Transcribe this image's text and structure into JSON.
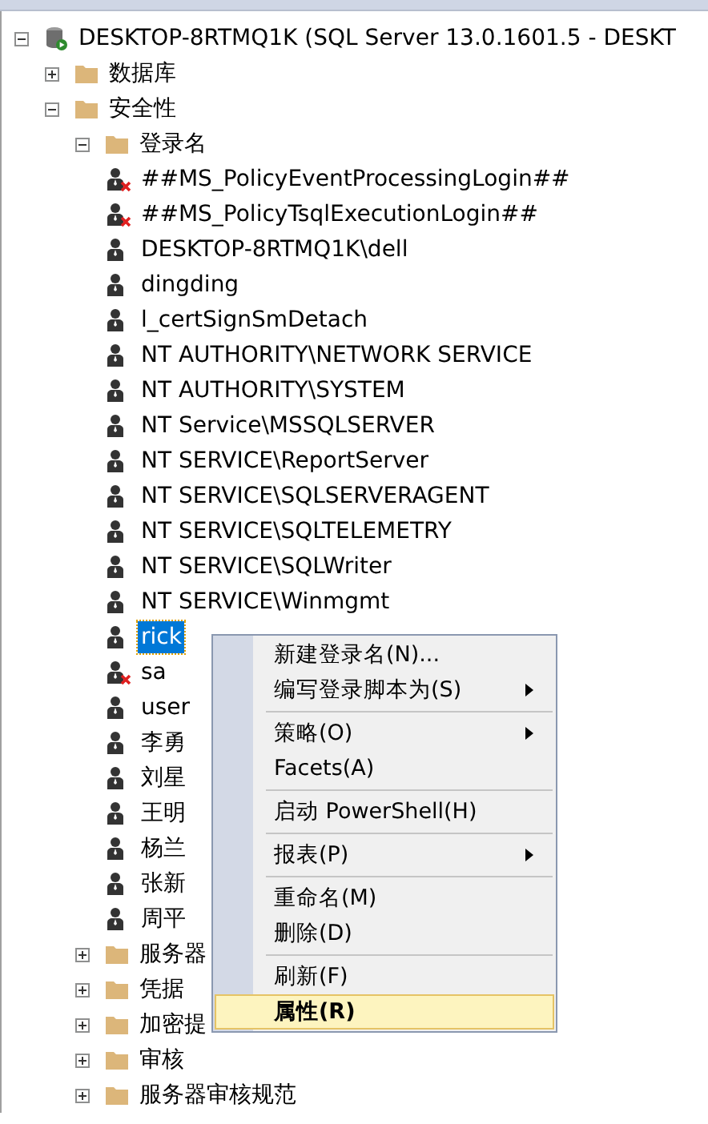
{
  "tree": {
    "label": "DESKTOP-8RTMQ1K (SQL Server 13.0.1601.5 - DESKT",
    "kind": "server",
    "expanded": true,
    "children": [
      {
        "label": "数据库",
        "kind": "folder",
        "expanded": false
      },
      {
        "label": "安全性",
        "kind": "folder",
        "expanded": true,
        "children": [
          {
            "label": "登录名",
            "kind": "folder",
            "expanded": true,
            "children": [
              {
                "label": "##MS_PolicyEventProcessingLogin##",
                "kind": "login",
                "disabled": true,
                "selected": false
              },
              {
                "label": "##MS_PolicyTsqlExecutionLogin##",
                "kind": "login",
                "disabled": true,
                "selected": false
              },
              {
                "label": "DESKTOP-8RTMQ1K\\dell",
                "kind": "login",
                "disabled": false,
                "selected": false
              },
              {
                "label": "dingding",
                "kind": "login",
                "disabled": false,
                "selected": false
              },
              {
                "label": "l_certSignSmDetach",
                "kind": "login",
                "disabled": false,
                "selected": false
              },
              {
                "label": "NT AUTHORITY\\NETWORK SERVICE",
                "kind": "login",
                "disabled": false,
                "selected": false
              },
              {
                "label": "NT AUTHORITY\\SYSTEM",
                "kind": "login",
                "disabled": false,
                "selected": false
              },
              {
                "label": "NT Service\\MSSQLSERVER",
                "kind": "login",
                "disabled": false,
                "selected": false
              },
              {
                "label": "NT SERVICE\\ReportServer",
                "kind": "login",
                "disabled": false,
                "selected": false
              },
              {
                "label": "NT SERVICE\\SQLSERVERAGENT",
                "kind": "login",
                "disabled": false,
                "selected": false
              },
              {
                "label": "NT SERVICE\\SQLTELEMETRY",
                "kind": "login",
                "disabled": false,
                "selected": false
              },
              {
                "label": "NT SERVICE\\SQLWriter",
                "kind": "login",
                "disabled": false,
                "selected": false
              },
              {
                "label": "NT SERVICE\\Winmgmt",
                "kind": "login",
                "disabled": false,
                "selected": false
              },
              {
                "label": "rick",
                "kind": "login",
                "disabled": false,
                "selected": true
              },
              {
                "label": "sa",
                "kind": "login",
                "disabled": true,
                "selected": false
              },
              {
                "label": "user",
                "kind": "login",
                "disabled": false,
                "selected": false
              },
              {
                "label": "李勇",
                "kind": "login",
                "disabled": false,
                "selected": false
              },
              {
                "label": "刘星",
                "kind": "login",
                "disabled": false,
                "selected": false
              },
              {
                "label": "王明",
                "kind": "login",
                "disabled": false,
                "selected": false
              },
              {
                "label": "杨兰",
                "kind": "login",
                "disabled": false,
                "selected": false
              },
              {
                "label": "张新",
                "kind": "login",
                "disabled": false,
                "selected": false
              },
              {
                "label": "周平",
                "kind": "login",
                "disabled": false,
                "selected": false
              }
            ]
          },
          {
            "label": "服务器",
            "kind": "folder",
            "expanded": false
          },
          {
            "label": "凭据",
            "kind": "folder",
            "expanded": false
          },
          {
            "label": "加密提",
            "kind": "folder",
            "expanded": false
          },
          {
            "label": "审核",
            "kind": "folder",
            "expanded": false
          },
          {
            "label": "服务器审核规范",
            "kind": "folder",
            "expanded": false
          }
        ]
      }
    ]
  },
  "context_menu": {
    "groups": [
      [
        {
          "label": "新建登录名(N)...",
          "submenu": false,
          "selected": false,
          "default": false
        },
        {
          "label": "编写登录脚本为(S)",
          "submenu": true,
          "selected": false,
          "default": false
        }
      ],
      [
        {
          "label": "策略(O)",
          "submenu": true,
          "selected": false,
          "default": false
        },
        {
          "label": "Facets(A)",
          "submenu": false,
          "selected": false,
          "default": false
        }
      ],
      [
        {
          "label": "启动 PowerShell(H)",
          "submenu": false,
          "selected": false,
          "default": false
        }
      ],
      [
        {
          "label": "报表(P)",
          "submenu": true,
          "selected": false,
          "default": false
        }
      ],
      [
        {
          "label": "重命名(M)",
          "submenu": false,
          "selected": false,
          "default": false
        },
        {
          "label": "删除(D)",
          "submenu": false,
          "selected": false,
          "default": false
        }
      ],
      [
        {
          "label": "刷新(F)",
          "submenu": false,
          "selected": false,
          "default": false
        },
        {
          "label": "属性(R)",
          "submenu": false,
          "selected": true,
          "default": true
        }
      ]
    ]
  }
}
